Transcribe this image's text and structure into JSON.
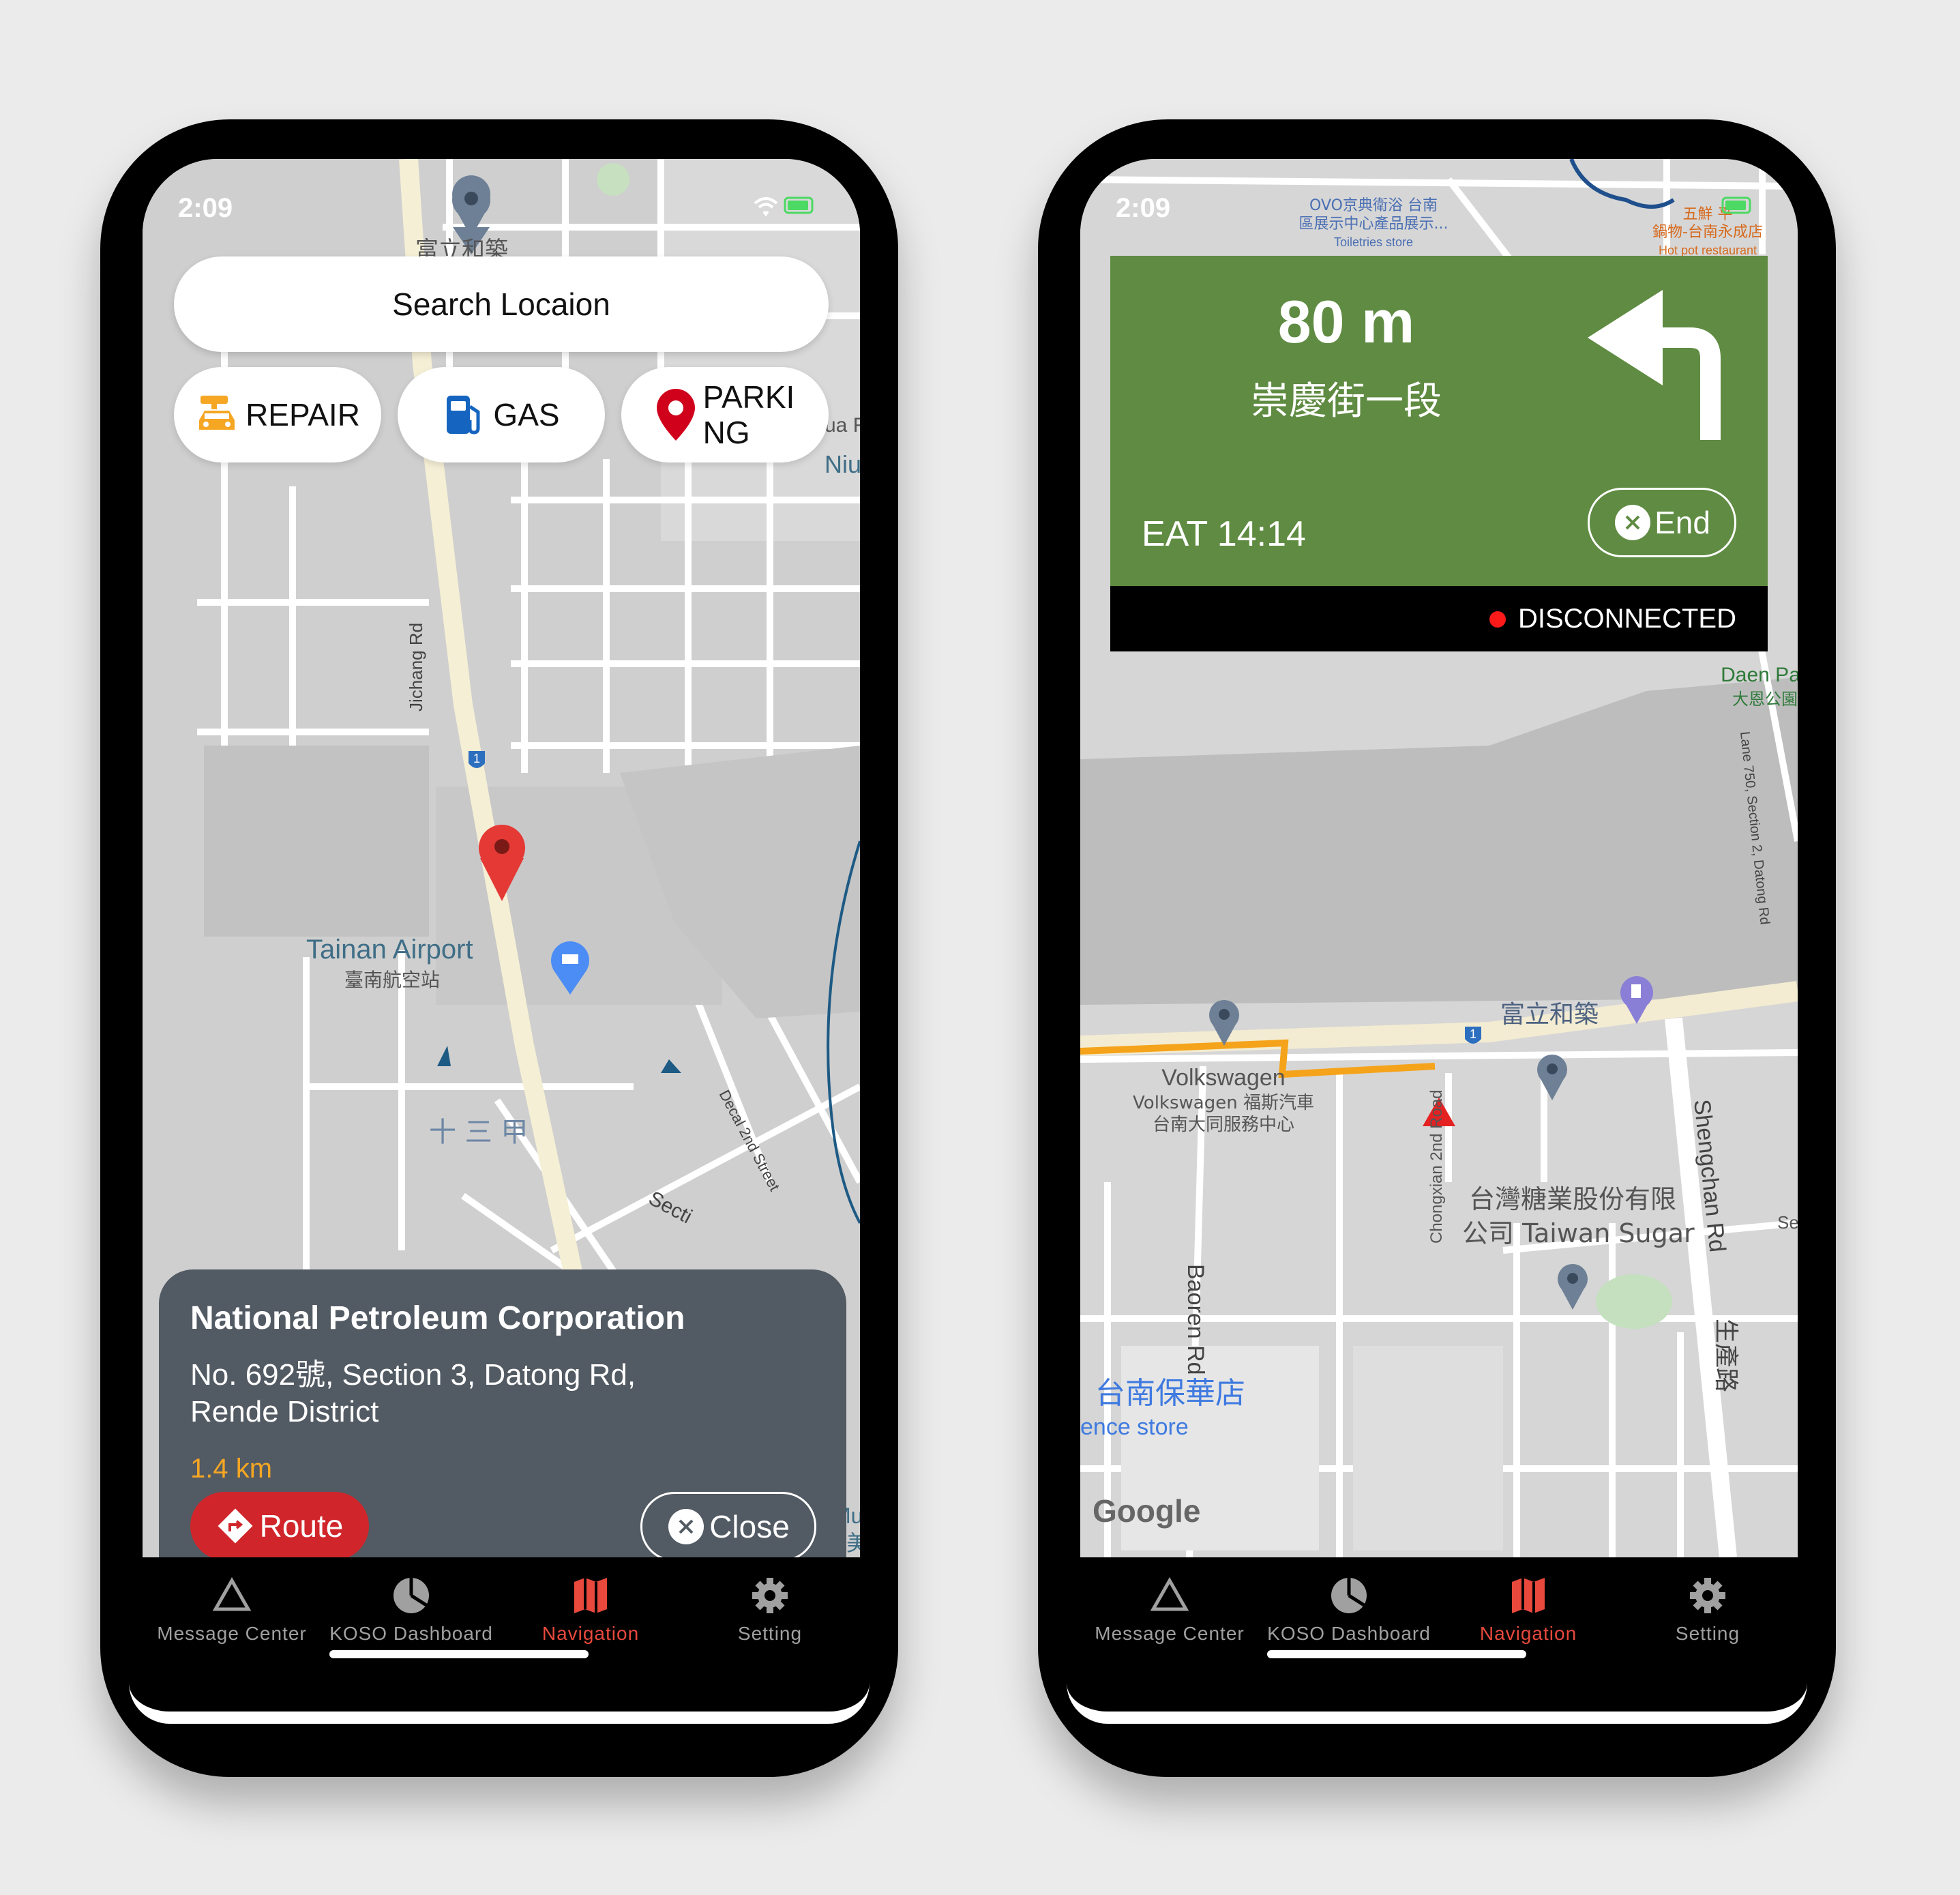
{
  "left_screen": {
    "status_time": "2:09",
    "search": {
      "placeholder": "Search Locaion"
    },
    "categories": [
      {
        "label": "REPAIR",
        "icon": "car-repair-icon",
        "color": "#f5a623"
      },
      {
        "label": "GAS",
        "icon": "gas-pump-icon",
        "color": "#1565c0"
      },
      {
        "label": "PARKI\nNG",
        "icon": "map-pin-icon",
        "color": "#d0021b"
      }
    ],
    "map_labels": {
      "airport_en": "Tainan Airport",
      "airport_zh": "臺南航空站",
      "jichang_rd": "Jichang Rd",
      "shisanjia": "十 三 甲",
      "decal_street": "Decal 2nd Street",
      "section": "Secti",
      "fuli": "富立和築",
      "niu": "Niu",
      "ua": "ua R",
      "museum_zh": "奇美博物",
      "museum_en": "Mu",
      "road_1": "1"
    },
    "info_card": {
      "title": "National Petroleum Corporation",
      "address_line1": "No. 692號, Section 3, Datong Rd,",
      "address_line2": "Rende District",
      "distance": "1.4 km",
      "route_label": "Route",
      "close_label": "Close"
    }
  },
  "right_screen": {
    "status_time": "2:09",
    "nav": {
      "distance": "80 m",
      "street": "崇慶街一段",
      "eat": "EAT 14:14",
      "end_label": "End",
      "connection_status": "DISCONNECTED",
      "panel_color": "#5f8b42"
    },
    "map_labels": {
      "ovo1": "OVO京典衛浴 台南",
      "ovo2": "區展示中心產品展示...",
      "ovo3": "Toiletries store",
      "hotpot1": "五鮮 平",
      "hotpot2": "鍋物-台南永成店",
      "hotpot3": "Hot pot restaurant",
      "daen_en": "Daen Park",
      "daen_zh": "大恩公園",
      "lane": "Lane 750, Section 2, Datong Rd",
      "fuli": "富立和築",
      "vw": "Volkswagen",
      "vw_zh1": "Volkswagen 福斯汽車",
      "vw_zh2": "台南大同服務中心",
      "chongxian": "Chongxian 2nd Road",
      "sugar_zh": "台灣糖業股份有限",
      "sugar_en": "公司 Taiwan Sugar",
      "shengchan": "Shengchan Rd",
      "shengchan_zh": "生產路",
      "baoren": "Baoren Rd",
      "store_zh": "台南保華店",
      "store_en": "ence store",
      "google": "Google",
      "se": "Se",
      "road_1": "1"
    }
  },
  "tabbar": {
    "tabs": [
      {
        "label": "Message Center",
        "icon": "triangle-icon"
      },
      {
        "label": "KOSO Dashboard",
        "icon": "dashboard-icon"
      },
      {
        "label": "Navigation",
        "icon": "map-icon",
        "active": true
      },
      {
        "label": "Setting",
        "icon": "gear-icon"
      }
    ],
    "active_color": "#e8493c"
  }
}
